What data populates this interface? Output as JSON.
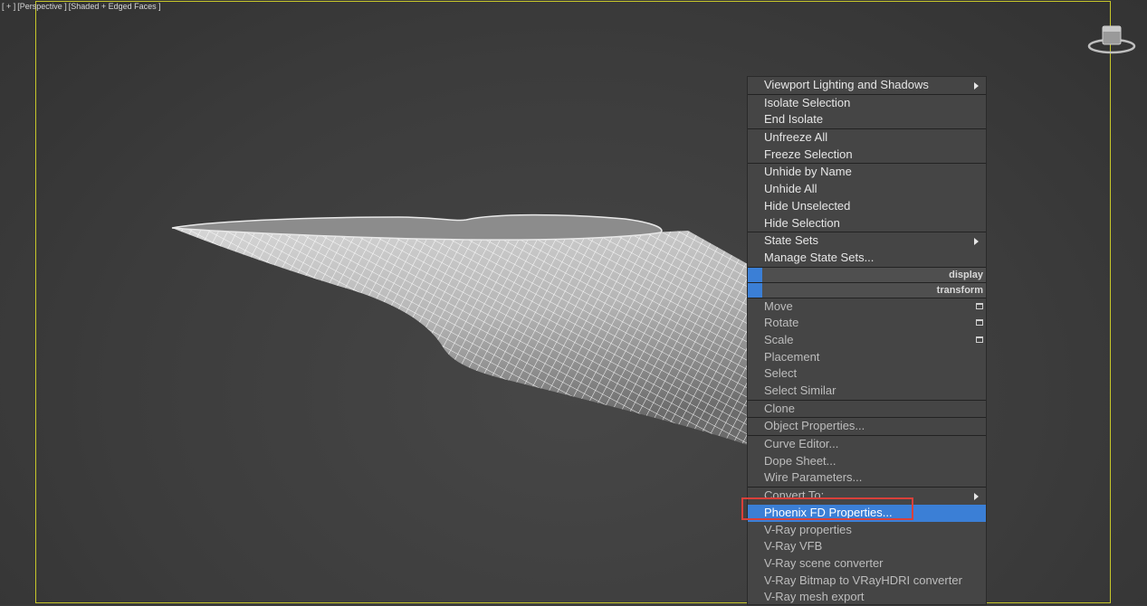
{
  "viewport": {
    "label_parts": [
      "[ + ]",
      "[Perspective ]",
      "[Shaded + Edged Faces ]"
    ]
  },
  "menu": {
    "items": [
      {
        "label": "Viewport Lighting and Shadows",
        "submenu": true
      },
      {
        "label": "Isolate Selection"
      },
      {
        "label": "End Isolate"
      },
      {
        "label": "Unfreeze All"
      },
      {
        "label": "Freeze Selection"
      },
      {
        "label": "Unhide by Name"
      },
      {
        "label": "Unhide All"
      },
      {
        "label": "Hide Unselected"
      },
      {
        "label": "Hide Selection"
      },
      {
        "label": "State Sets",
        "submenu": true
      },
      {
        "label": "Manage State Sets..."
      },
      {
        "label": "display"
      },
      {
        "label": "transform"
      },
      {
        "label": "Move"
      },
      {
        "label": "Rotate"
      },
      {
        "label": "Scale"
      },
      {
        "label": "Placement"
      },
      {
        "label": "Select"
      },
      {
        "label": "Select Similar"
      },
      {
        "label": "Clone"
      },
      {
        "label": "Object Properties..."
      },
      {
        "label": "Curve Editor..."
      },
      {
        "label": "Dope Sheet..."
      },
      {
        "label": "Wire Parameters..."
      },
      {
        "label": "Convert To:",
        "submenu": true
      },
      {
        "label": "Phoenix FD Properties...",
        "highlighted": true
      },
      {
        "label": "V-Ray properties"
      },
      {
        "label": "V-Ray VFB"
      },
      {
        "label": "V-Ray scene converter"
      },
      {
        "label": "V-Ray Bitmap to VRayHDRI converter"
      },
      {
        "label": "V-Ray mesh export"
      }
    ]
  },
  "colors": {
    "highlight": "#3b7fd6",
    "annotation": "#d9403a",
    "viewport_border": "#c7c72a"
  }
}
